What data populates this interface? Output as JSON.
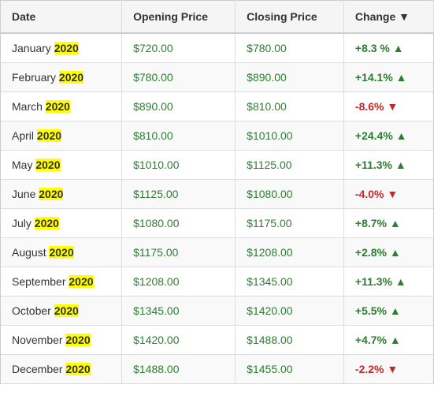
{
  "table": {
    "headers": [
      "Date",
      "Opening Price",
      "Closing Price",
      "Change ▼"
    ],
    "rows": [
      {
        "month": "January",
        "year": "2020",
        "opening": "$720.00",
        "closing": "$780.00",
        "change": "+8.3 %",
        "direction": "up"
      },
      {
        "month": "February",
        "year": "2020",
        "opening": "$780.00",
        "closing": "$890.00",
        "change": "+14.1%",
        "direction": "up"
      },
      {
        "month": "March",
        "year": "2020",
        "opening": "$890.00",
        "closing": "$810.00",
        "change": "-8.6%",
        "direction": "down"
      },
      {
        "month": "April",
        "year": "2020",
        "opening": "$810.00",
        "closing": "$1010.00",
        "change": "+24.4%",
        "direction": "up"
      },
      {
        "month": "May",
        "year": "2020",
        "opening": "$1010.00",
        "closing": "$1125.00",
        "change": "+11.3%",
        "direction": "up"
      },
      {
        "month": "June",
        "year": "2020",
        "opening": "$1125.00",
        "closing": "$1080.00",
        "change": "-4.0%",
        "direction": "down"
      },
      {
        "month": "July",
        "year": "2020",
        "opening": "$1080.00",
        "closing": "$1175.00",
        "change": "+8.7%",
        "direction": "up"
      },
      {
        "month": "August",
        "year": "2020",
        "opening": "$1175.00",
        "closing": "$1208.00",
        "change": "+2.8%",
        "direction": "up"
      },
      {
        "month": "September",
        "year": "2020",
        "opening": "$1208.00",
        "closing": "$1345.00",
        "change": "+11.3%",
        "direction": "up"
      },
      {
        "month": "October",
        "year": "2020",
        "opening": "$1345.00",
        "closing": "$1420.00",
        "change": "+5.5%",
        "direction": "up"
      },
      {
        "month": "November",
        "year": "2020",
        "opening": "$1420.00",
        "closing": "$1488.00",
        "change": "+4.7%",
        "direction": "up"
      },
      {
        "month": "December",
        "year": "2020",
        "opening": "$1488.00",
        "closing": "$1455.00",
        "change": "-2.2%",
        "direction": "down"
      }
    ]
  }
}
